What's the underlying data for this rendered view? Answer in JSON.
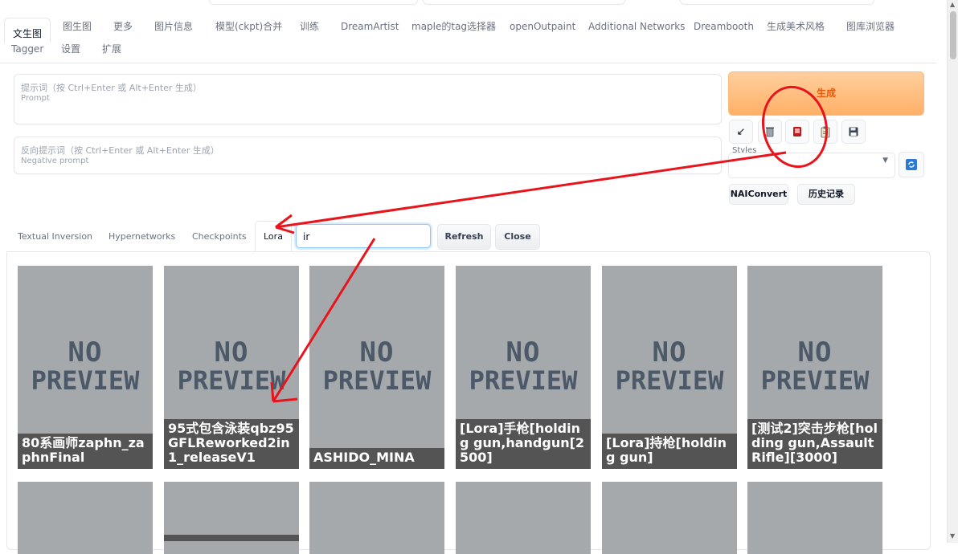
{
  "main_tabs": [
    "文生图",
    "图生图",
    "更多",
    "图片信息",
    "模型(ckpt)合并",
    "训练",
    "DreamArtist",
    "maple的tag选择器",
    "openOutpaint",
    "Additional Networks",
    "Dreambooth",
    "生成美术风格",
    "图库浏览器",
    "Tagger",
    "设置",
    "扩展"
  ],
  "prompt": {
    "placeholder_cn": "提示词（按 Ctrl+Enter 或 Alt+Enter 生成）",
    "placeholder_en": "Prompt"
  },
  "negative_prompt": {
    "placeholder_cn": "反向提示词（按 Ctrl+Enter 或 Alt+Enter 生成）",
    "placeholder_en": "Negative prompt"
  },
  "generate_label": "生成",
  "tools": {
    "paste_icon": "↙",
    "trash_icon": "trash-icon",
    "card_icon": "red-card-icon",
    "clipboard_icon": "clipboard-icon",
    "save_icon": "floppy-icon"
  },
  "styles": {
    "label": "Styles",
    "value": ""
  },
  "naiconvert_label": "NAIConvert",
  "history_label": "历史记录",
  "extra_tabs": [
    "Textual Inversion",
    "Hypernetworks",
    "Checkpoints",
    "Lora"
  ],
  "search_value": "ir",
  "refresh_label": "Refresh",
  "close_label": "Close",
  "no_preview": {
    "line1": "NO",
    "line2": "PREVIEW"
  },
  "cards": [
    {
      "caption": "80系画师zaphn_zaphnFinal"
    },
    {
      "caption": "95式包含泳装qbz95GFLReworked2in1_releaseV1"
    },
    {
      "caption": "ASHIDO_MINA"
    },
    {
      "caption": "[Lora]手枪[holding gun,handgun[2500]"
    },
    {
      "caption": "[Lora]持枪[holding gun]"
    },
    {
      "caption": "[测试2]突击步枪[holding gun,Assault Rifle][3000]"
    }
  ],
  "colors": {
    "annotation_red": "#e8141c",
    "generate_orange": "#ea580c"
  }
}
